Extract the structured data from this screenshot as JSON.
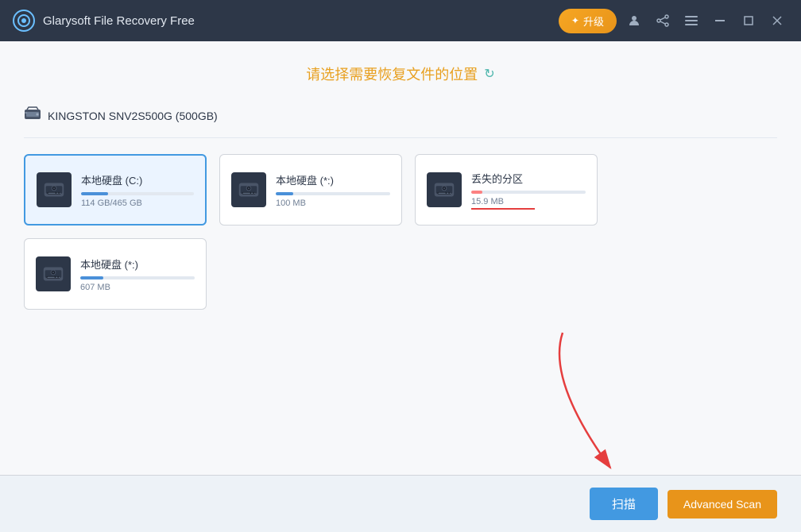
{
  "titleBar": {
    "logo": "G",
    "title": "Glarysoft File Recovery Free",
    "upgradeBtnLabel": "升级",
    "profileIcon": "👤",
    "shareIcon": "share",
    "menuIcon": "≡",
    "minimizeIcon": "—",
    "maximizeIcon": "□",
    "closeIcon": "✕"
  },
  "page": {
    "headerTitle": "请选择需要恢复文件的位置",
    "refreshTooltip": "刷新"
  },
  "diskGroup": {
    "name": "KINGSTON SNV2S500G (500GB)"
  },
  "drives": [
    {
      "id": "drive-c",
      "name": "本地硬盘 (C:)",
      "size": "114 GB/465 GB",
      "barPercent": 24,
      "selected": true,
      "lostPartition": false
    },
    {
      "id": "drive-star1",
      "name": "本地硬盘 (*:)",
      "size": "100 MB",
      "barPercent": 15,
      "selected": false,
      "lostPartition": false
    },
    {
      "id": "drive-lost",
      "name": "丢失的分区",
      "size": "15.9 MB",
      "barPercent": 10,
      "selected": false,
      "lostPartition": true
    },
    {
      "id": "drive-star2",
      "name": "本地硬盘 (*:)",
      "size": "607 MB",
      "barPercent": 20,
      "selected": false,
      "lostPartition": false
    }
  ],
  "bottomBar": {
    "scanBtnLabel": "扫描",
    "advancedScanBtnLabel": "Advanced Scan"
  }
}
